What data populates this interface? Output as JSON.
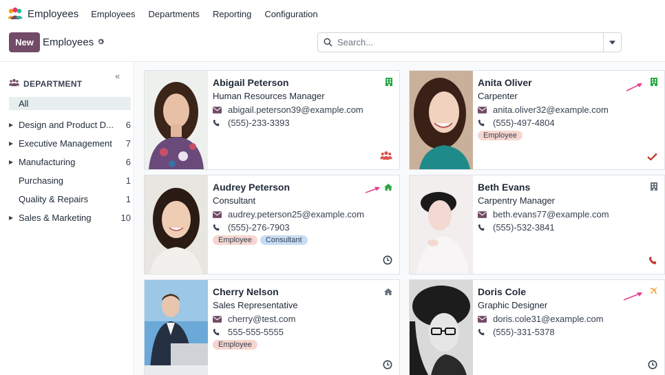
{
  "app": {
    "name": "Employees",
    "nav": [
      "Employees",
      "Departments",
      "Reporting",
      "Configuration"
    ]
  },
  "control": {
    "new_label": "New",
    "title": "Employees",
    "search_placeholder": "Search..."
  },
  "sidebar": {
    "collapse": "«",
    "heading": "DEPARTMENT",
    "items": [
      {
        "label": "All",
        "count": "",
        "active": true,
        "expandable": false
      },
      {
        "label": "Design and Product D...",
        "count": "6",
        "expandable": true
      },
      {
        "label": "Executive Management",
        "count": "7",
        "expandable": true
      },
      {
        "label": "Manufacturing",
        "count": "6",
        "expandable": true
      },
      {
        "label": "Purchasing",
        "count": "1",
        "expandable": false
      },
      {
        "label": "Quality & Repairs",
        "count": "1",
        "expandable": false
      },
      {
        "label": "Sales & Marketing",
        "count": "10",
        "expandable": true
      }
    ]
  },
  "employees": [
    {
      "name": "Abigail Peterson",
      "job": "Human Resources Manager",
      "email": "abigail.peterson39@example.com",
      "phone": "(555)-233-3393",
      "tags": [],
      "status_icon": "building-icon",
      "status_color": "#28a745",
      "bottom_icon": "users-icon"
    },
    {
      "name": "Anita Oliver",
      "job": "Carpenter",
      "email": "anita.oliver32@example.com",
      "phone": "(555)-497-4804",
      "tags": [
        "Employee"
      ],
      "status_icon": "building-icon",
      "status_color": "#28a745",
      "bottom_icon": "check-icon"
    },
    {
      "name": "Audrey Peterson",
      "job": "Consultant",
      "email": "audrey.peterson25@example.com",
      "phone": "(555)-276-7903",
      "tags": [
        "Employee",
        "Consultant"
      ],
      "status_icon": "home-icon",
      "status_color": "#28a745",
      "bottom_icon": "clock-icon"
    },
    {
      "name": "Beth Evans",
      "job": "Carpentry Manager",
      "email": "beth.evans77@example.com",
      "phone": "(555)-532-3841",
      "tags": [],
      "status_icon": "building-icon",
      "status_color": "#6b7280",
      "bottom_icon": "phone-icon"
    },
    {
      "name": "Cherry Nelson",
      "job": "Sales Representative",
      "email": "cherry@test.com",
      "phone": "555-555-5555",
      "tags": [
        "Employee"
      ],
      "status_icon": "home-icon",
      "status_color": "#6b7280",
      "bottom_icon": "clock-icon"
    },
    {
      "name": "Doris Cole",
      "job": "Graphic Designer",
      "email": "doris.cole31@example.com",
      "phone": "(555)-331-5378",
      "tags": [],
      "status_icon": "plane-icon",
      "status_color": "#f0ad4e",
      "bottom_icon": "clock-icon"
    }
  ],
  "colors": {
    "brand": "#714b67",
    "arrow": "#e83e8c",
    "online": "#28a745",
    "danger": "#c0392b"
  }
}
